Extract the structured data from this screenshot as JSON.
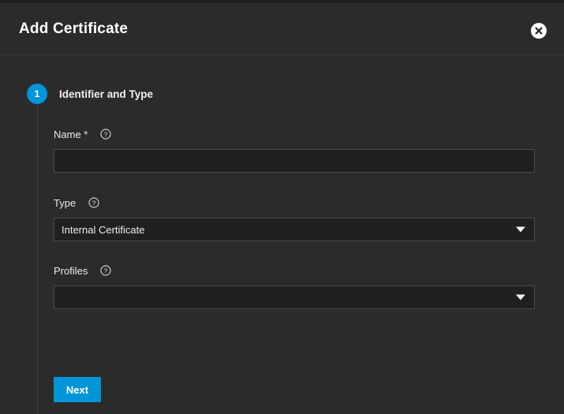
{
  "dialog": {
    "title": "Add Certificate",
    "close_icon": "close-circle-icon"
  },
  "step": {
    "number": "1",
    "title": "Identifier and Type",
    "accent_color": "#0095d9"
  },
  "form": {
    "fields": [
      {
        "label": "Name *",
        "help_icon": "question-circle-icon",
        "control": "text",
        "value": "",
        "placeholder": ""
      },
      {
        "label": "Type",
        "help_icon": "question-circle-icon",
        "control": "select",
        "value": "Internal Certificate",
        "arrow_icon": "chevron-down-icon"
      },
      {
        "label": "Profiles",
        "help_icon": "question-circle-icon",
        "control": "select",
        "value": "",
        "arrow_icon": "chevron-down-icon"
      }
    ]
  },
  "actions": {
    "next_label": "Next"
  },
  "colors": {
    "background": "#2b2b2b",
    "input_background": "#202020",
    "input_border": "#4a4a4a",
    "accent": "#0095d9",
    "text": "#e8e8e8"
  }
}
